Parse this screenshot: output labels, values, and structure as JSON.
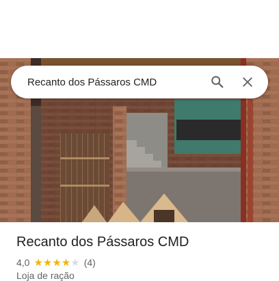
{
  "search": {
    "query": "Recanto dos Pássaros CMD",
    "search_icon": "search-icon",
    "close_icon": "close-icon"
  },
  "place": {
    "name": "Recanto dos Pássaros CMD",
    "rating": "4,0",
    "stars_filled": 4,
    "stars_total": 5,
    "review_count": "(4)",
    "category": "Loja de ração"
  },
  "colors": {
    "star_on": "#f4b400",
    "star_off": "#dadce0",
    "icon": "#5f6368"
  }
}
